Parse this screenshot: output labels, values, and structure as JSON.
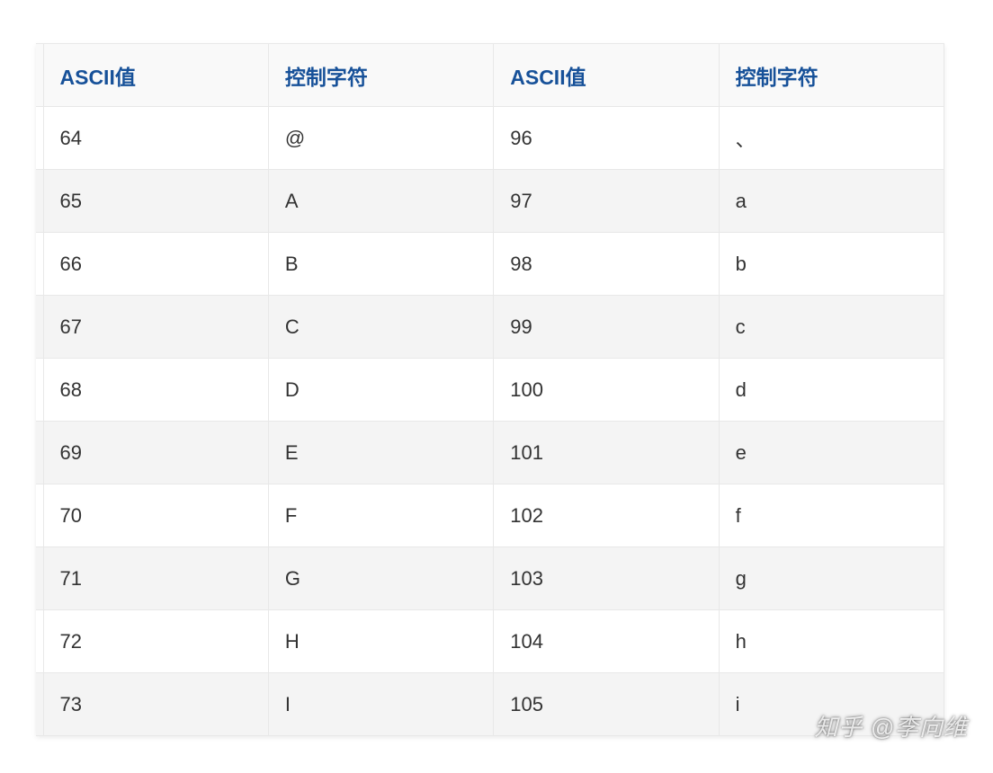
{
  "chart_data": {
    "type": "table",
    "title": "",
    "columns": [
      "ASCII值",
      "控制字符",
      "ASCII值",
      "控制字符"
    ],
    "rows": [
      [
        "64",
        "@",
        "96",
        "、"
      ],
      [
        "65",
        "A",
        "97",
        "a"
      ],
      [
        "66",
        "B",
        "98",
        "b"
      ],
      [
        "67",
        "C",
        "99",
        "c"
      ],
      [
        "68",
        "D",
        "100",
        "d"
      ],
      [
        "69",
        "E",
        "101",
        "e"
      ],
      [
        "70",
        "F",
        "102",
        "f"
      ],
      [
        "71",
        "G",
        "103",
        "g"
      ],
      [
        "72",
        "H",
        "104",
        "h"
      ],
      [
        "73",
        "I",
        "105",
        "i"
      ]
    ]
  },
  "watermark": "知乎 @李向维"
}
